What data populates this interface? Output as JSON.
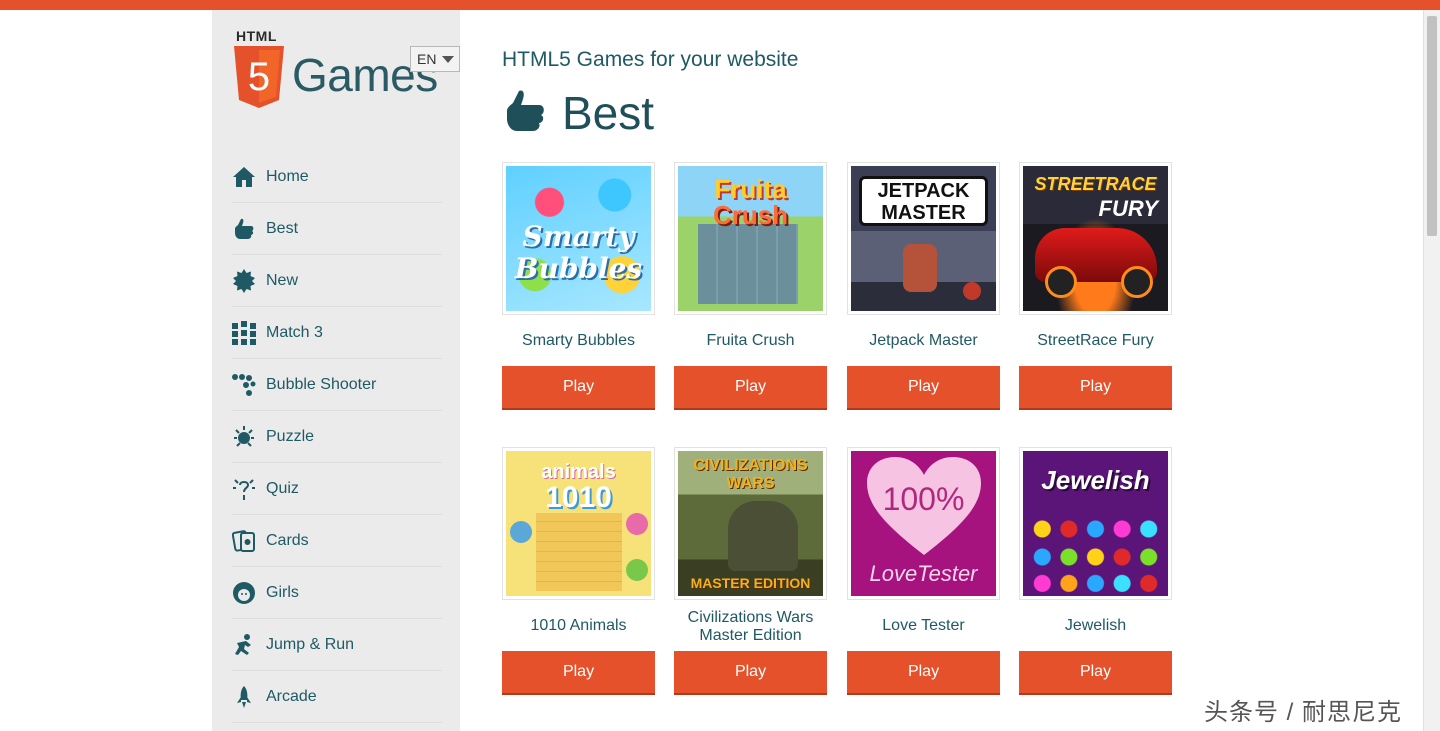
{
  "brand": {
    "html_label": "HTML",
    "shield_number": "5",
    "games_label": "Games",
    "language": "EN"
  },
  "nav": [
    {
      "label": "Home",
      "icon": "home-icon"
    },
    {
      "label": "Best",
      "icon": "thumbs-up-icon"
    },
    {
      "label": "New",
      "icon": "new-badge-icon"
    },
    {
      "label": "Match 3",
      "icon": "grid-icon"
    },
    {
      "label": "Bubble Shooter",
      "icon": "bubbles-icon"
    },
    {
      "label": "Puzzle",
      "icon": "puzzle-icon"
    },
    {
      "label": "Quiz",
      "icon": "quiz-icon"
    },
    {
      "label": "Cards",
      "icon": "cards-icon"
    },
    {
      "label": "Girls",
      "icon": "girl-icon"
    },
    {
      "label": "Jump & Run",
      "icon": "jump-icon"
    },
    {
      "label": "Arcade",
      "icon": "rocket-icon"
    }
  ],
  "main": {
    "subtitle": "HTML5 Games for your website",
    "heading": "Best",
    "play_label": "Play",
    "games": [
      {
        "title": "Smarty Bubbles",
        "art_text": [
          "Smarty",
          "Bubbles"
        ]
      },
      {
        "title": "Fruita Crush",
        "art_text": [
          "Fruita",
          "Crush"
        ]
      },
      {
        "title": "Jetpack Master",
        "art_text": [
          "JETPACK",
          "MASTER"
        ]
      },
      {
        "title": "StreetRace Fury",
        "art_text": [
          "STREETRACE",
          "FURY"
        ]
      },
      {
        "title": "1010 Animals",
        "art_text": [
          "animals",
          "1010"
        ]
      },
      {
        "title": "Civilizations Wars Master Edition",
        "art_text": [
          "CIVILIZATIONS",
          "WARS",
          "MASTER EDITION"
        ]
      },
      {
        "title": "Love Tester",
        "art_text": [
          "100%",
          "LoveTester"
        ]
      },
      {
        "title": "Jewelish",
        "art_text": [
          "Jewelish"
        ]
      }
    ]
  },
  "watermark": "头条号 / 耐思尼克",
  "colors": {
    "accent": "#e4512b",
    "text": "#1f5964",
    "sidebar": "#ebebeb"
  }
}
